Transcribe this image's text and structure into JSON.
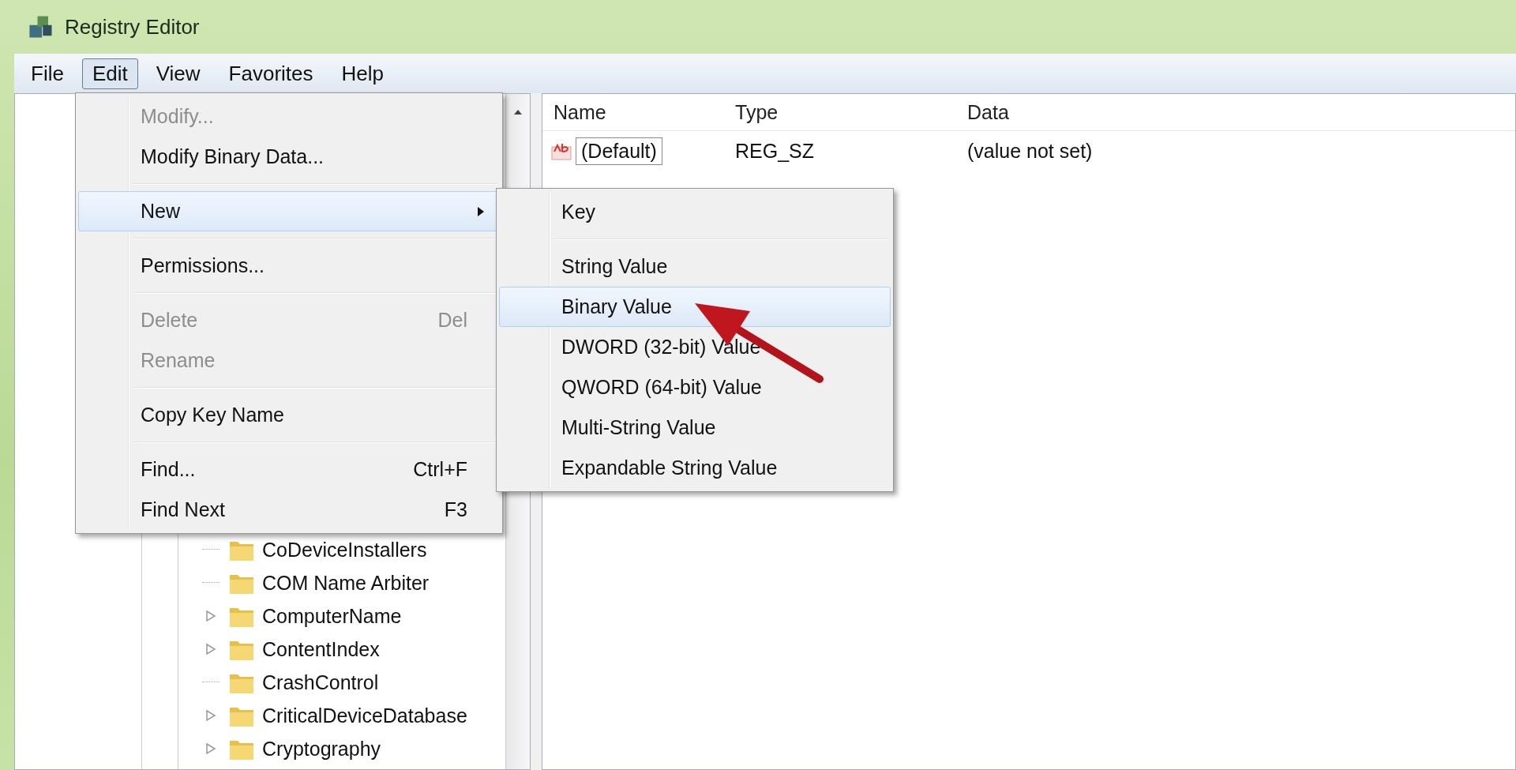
{
  "window": {
    "title": "Registry Editor"
  },
  "menu_bar": [
    {
      "label": "File",
      "selected": false
    },
    {
      "label": "Edit",
      "selected": true
    },
    {
      "label": "View",
      "selected": false
    },
    {
      "label": "Favorites",
      "selected": false
    },
    {
      "label": "Help",
      "selected": false
    }
  ],
  "edit_menu": {
    "groups": [
      [
        {
          "label": "Modify...",
          "disabled": true,
          "highlighted": false,
          "submenu": false
        },
        {
          "label": "Modify Binary Data...",
          "disabled": false,
          "highlighted": false,
          "submenu": false
        }
      ],
      [
        {
          "label": "New",
          "disabled": false,
          "highlighted": true,
          "submenu": true
        }
      ],
      [
        {
          "label": "Permissions...",
          "disabled": false,
          "highlighted": false,
          "submenu": false
        }
      ],
      [
        {
          "label": "Delete",
          "shortcut": "Del",
          "disabled": true,
          "highlighted": false,
          "submenu": false
        },
        {
          "label": "Rename",
          "disabled": true,
          "highlighted": false,
          "submenu": false
        }
      ],
      [
        {
          "label": "Copy Key Name",
          "disabled": false,
          "highlighted": false,
          "submenu": false
        }
      ],
      [
        {
          "label": "Find...",
          "shortcut": "Ctrl+F",
          "disabled": false,
          "highlighted": false,
          "submenu": false
        },
        {
          "label": "Find Next",
          "shortcut": "F3",
          "disabled": false,
          "highlighted": false,
          "submenu": false
        }
      ]
    ]
  },
  "new_submenu": {
    "groups": [
      [
        {
          "label": "Key",
          "highlighted": false
        }
      ],
      [
        {
          "label": "String Value",
          "highlighted": false
        },
        {
          "label": "Binary Value",
          "highlighted": true
        },
        {
          "label": "DWORD (32-bit) Value",
          "highlighted": false
        },
        {
          "label": "QWORD (64-bit) Value",
          "highlighted": false
        },
        {
          "label": "Multi-String Value",
          "highlighted": false
        },
        {
          "label": "Expandable String Value",
          "highlighted": false
        }
      ]
    ]
  },
  "tree": {
    "items": [
      {
        "label": "CoDeviceInstallers",
        "expandable": false
      },
      {
        "label": "COM Name Arbiter",
        "expandable": false
      },
      {
        "label": "ComputerName",
        "expandable": true
      },
      {
        "label": "ContentIndex",
        "expandable": true
      },
      {
        "label": "CrashControl",
        "expandable": false
      },
      {
        "label": "CriticalDeviceDatabase",
        "expandable": true
      },
      {
        "label": "Cryptography",
        "expandable": true
      }
    ]
  },
  "values": {
    "columns": [
      "Name",
      "Type",
      "Data"
    ],
    "rows": [
      {
        "name": "(Default)",
        "type": "REG_SZ",
        "data": "(value not set)",
        "editing": true
      }
    ]
  }
}
